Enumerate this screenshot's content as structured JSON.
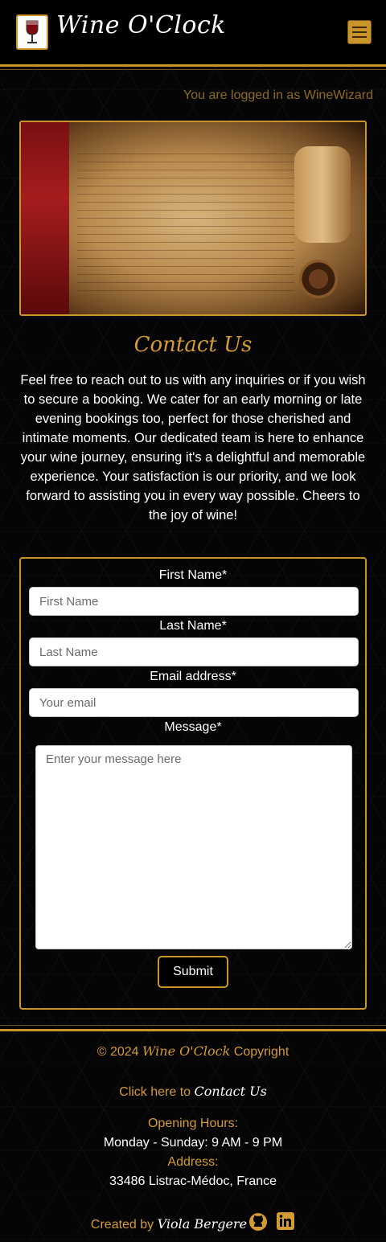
{
  "header": {
    "brand": "Wine O'Clock",
    "logo_icon": "wine-glass-logo",
    "menu_icon": "hamburger-menu-icon"
  },
  "session": {
    "logged_in_text": "You are logged in as WineWizard"
  },
  "hero": {
    "image_name": "parchment-scroll-image"
  },
  "contact": {
    "title": "Contact Us",
    "intro": "Feel free to reach out to us with any inquiries or if you wish to secure a booking. We cater for an early morning or late evening bookings too, perfect for those cherished and intimate moments. Our dedicated team is here to enhance your wine journey, ensuring it's a delightful and memorable experience. Your satisfaction is our priority, and we look forward to assisting you in every way possible. Cheers to the joy of wine!"
  },
  "form": {
    "first_name_label": "First Name*",
    "first_name_placeholder": "First Name",
    "last_name_label": "Last Name*",
    "last_name_placeholder": "Last Name",
    "email_label": "Email address*",
    "email_placeholder": "Your email",
    "message_label": "Message*",
    "message_placeholder": "Enter your message here",
    "submit_label": "Submit"
  },
  "footer": {
    "copyright_prefix": "© 2024",
    "copyright_brand": "Wine O'Clock",
    "copyright_suffix": "Copyright",
    "contact_prefix": "Click here to",
    "contact_link": "Contact Us",
    "hours_label": "Opening Hours:",
    "hours_value": "Monday - Sunday: 9 AM - 9 PM",
    "address_label": "Address:",
    "address_value": "33486 Listrac-Médoc, France",
    "created_prefix": "Created by",
    "created_name": "Viola Bergere",
    "icons": [
      "github-icon",
      "linkedin-icon"
    ]
  },
  "colors": {
    "accent_gold": "#c9952b",
    "text_gold": "#d49a34",
    "background": "#050505"
  }
}
